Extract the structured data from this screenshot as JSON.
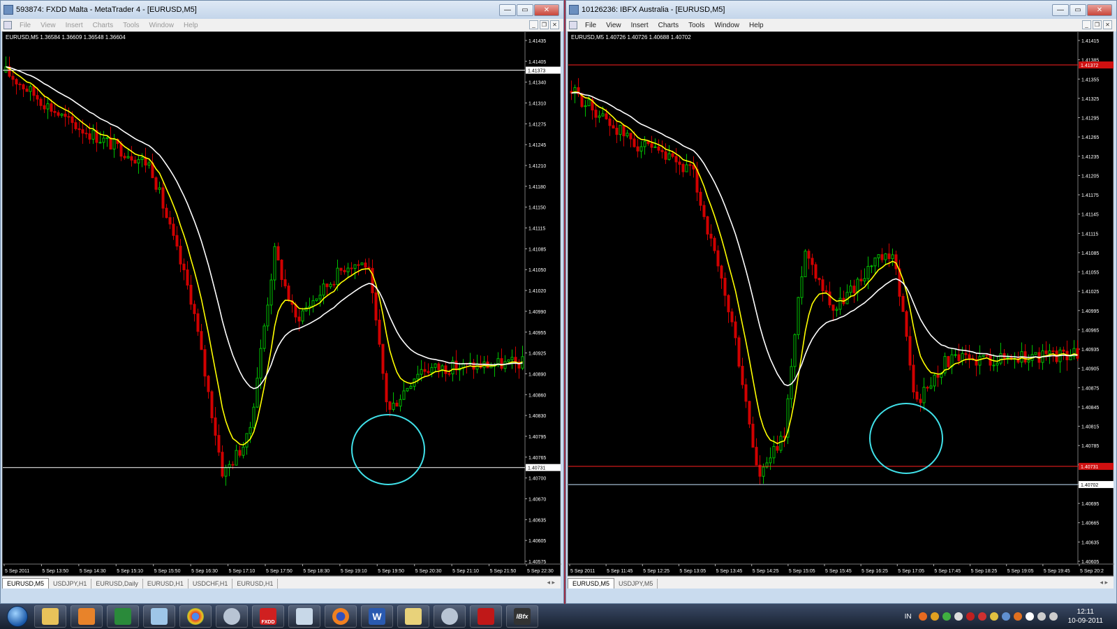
{
  "windows": [
    {
      "id": "left",
      "title": "593874: FXDD Malta - MetaTrader 4 - [EURUSD,M5]",
      "menu_dim": true,
      "menu": [
        "File",
        "View",
        "Insert",
        "Charts",
        "Tools",
        "Window",
        "Help"
      ],
      "symbol_label": "EURUSD,M5  1.36584 1.36609 1.36548 1.36604",
      "price_min": 1.40575,
      "price_max": 1.4143,
      "price_labels": [
        "1.41435",
        "1.41405",
        "1.41340",
        "1.41310",
        "1.41275",
        "1.41245",
        "1.41210",
        "1.41180",
        "1.41150",
        "1.41115",
        "1.41085",
        "1.41050",
        "1.41020",
        "1.40990",
        "1.40955",
        "1.40925",
        "1.40890",
        "1.40860",
        "1.40830",
        "1.40795",
        "1.40765",
        "1.40700",
        "1.40670",
        "1.40635",
        "1.40605",
        "1.40575"
      ],
      "hlines": [
        {
          "price": 1.41373,
          "label": "1.41373",
          "color": "#ffffff"
        },
        {
          "price": 1.40731,
          "label": "1.40731",
          "color": "#ffffff"
        }
      ],
      "time_labels": [
        "5 Sep 2011",
        "5 Sep 13:50",
        "5 Sep 14:30",
        "5 Sep 15:10",
        "5 Sep 15:50",
        "5 Sep 16:30",
        "5 Sep 17:10",
        "5 Sep 17:50",
        "5 Sep 18:30",
        "5 Sep 19:10",
        "5 Sep 19:50",
        "5 Sep 20:30",
        "5 Sep 21:10",
        "5 Sep 21:50",
        "5 Sep 22:30"
      ],
      "tabs": [
        "EURUSD,M5",
        "USDJPY,H1",
        "EURUSD,Daily",
        "EURUSD,H1",
        "USDCHF,H1",
        "EURUSD,H1"
      ],
      "active_tab": 0
    },
    {
      "id": "right",
      "title": "10126236: IBFX Australia - [EURUSD,M5]",
      "menu_dim": false,
      "menu": [
        "File",
        "View",
        "Insert",
        "Charts",
        "Tools",
        "Window",
        "Help"
      ],
      "symbol_label": "EURUSD,M5  1.40726 1.40726 1.40688 1.40702",
      "price_min": 1.40575,
      "price_max": 1.4142,
      "price_labels": [
        "1.41415",
        "1.41385",
        "1.41355",
        "1.41325",
        "1.41295",
        "1.41265",
        "1.41235",
        "1.41205",
        "1.41175",
        "1.41145",
        "1.41115",
        "1.41085",
        "1.41055",
        "1.41025",
        "1.40995",
        "1.40965",
        "1.40935",
        "1.40905",
        "1.40875",
        "1.40845",
        "1.40815",
        "1.40785",
        "1.40755",
        "1.40725",
        "1.40695",
        "1.40665",
        "1.40635",
        "1.40605"
      ],
      "hlines": [
        {
          "price": 1.41372,
          "label": "1.41372",
          "color": "#ff2020"
        },
        {
          "price": 1.40731,
          "label": "1.40731",
          "color": "#ff2020"
        },
        {
          "price": 1.40702,
          "label": "1.40702",
          "color": "#c8e6ff"
        }
      ],
      "time_labels": [
        "5 Sep 2011",
        "5 Sep 11:45",
        "5 Sep 12:25",
        "5 Sep 13:05",
        "5 Sep 13:45",
        "5 Sep 14:25",
        "5 Sep 15:05",
        "5 Sep 15:45",
        "5 Sep 16:25",
        "5 Sep 17:05",
        "5 Sep 17:45",
        "5 Sep 18:25",
        "5 Sep 19:05",
        "5 Sep 19:45",
        "5 Sep 20:2"
      ],
      "tabs": [
        "EURUSD,M5",
        "USDJPY,M5"
      ],
      "active_tab": 0
    }
  ],
  "colors": {
    "bull": "#00c000",
    "bear": "#d00000",
    "fast_ma": "#ffff00",
    "slow_ma": "#ffffff",
    "highlight_circle": "#40e0e8"
  },
  "taskbar": {
    "apps": [
      "explorer-icon",
      "media-player-icon",
      "excel-icon",
      "notepad-icon",
      "chrome-icon",
      "lock-icon",
      "fxdd-icon",
      "calculator-icon",
      "firefox-icon",
      "word-icon",
      "folder-icon",
      "lock-icon-2",
      "acrobat-icon",
      "ibfx-icon"
    ],
    "fxdd_label": "FXDD",
    "ibfx_label": "IBfx",
    "lang": "IN",
    "time": "12:11",
    "date": "10-09-2011"
  }
}
